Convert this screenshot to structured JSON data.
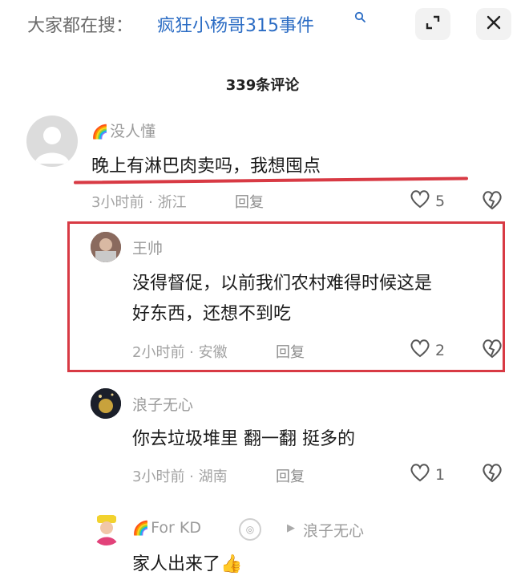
{
  "header": {
    "search_prefix": "大家都在搜：",
    "search_term": "疯狂小杨哥315事件",
    "search_icon": "search-icon",
    "expand_icon": "expand-icon",
    "close_icon": "close-icon"
  },
  "comments_title": "339条评论",
  "comments": [
    {
      "user": "没人懂",
      "has_rainbow": true,
      "text": "晚上有淋巴肉卖吗，我想囤点",
      "meta": "3小时前 · 浙江",
      "reply": "回复",
      "likes": "5"
    },
    {
      "user": "王帅",
      "text_line1": "没得督促，以前我们农村难得时候这是",
      "text_line2": "好东西，还想不到吃",
      "meta": "2小时前 · 安徽",
      "reply": "回复",
      "likes": "2"
    },
    {
      "user": "浪子无心",
      "text": "你去垃圾堆里 翻一翻 挺多的",
      "meta": "3小时前 · 湖南",
      "reply": "回复",
      "likes": "1"
    },
    {
      "user": "For KD",
      "has_rainbow": true,
      "reply_to": "浪子无心",
      "text": "家人出来了",
      "emoji": "👍"
    }
  ],
  "colors": {
    "highlight_red": "#d83a44",
    "link_blue": "#2b6cc4"
  }
}
